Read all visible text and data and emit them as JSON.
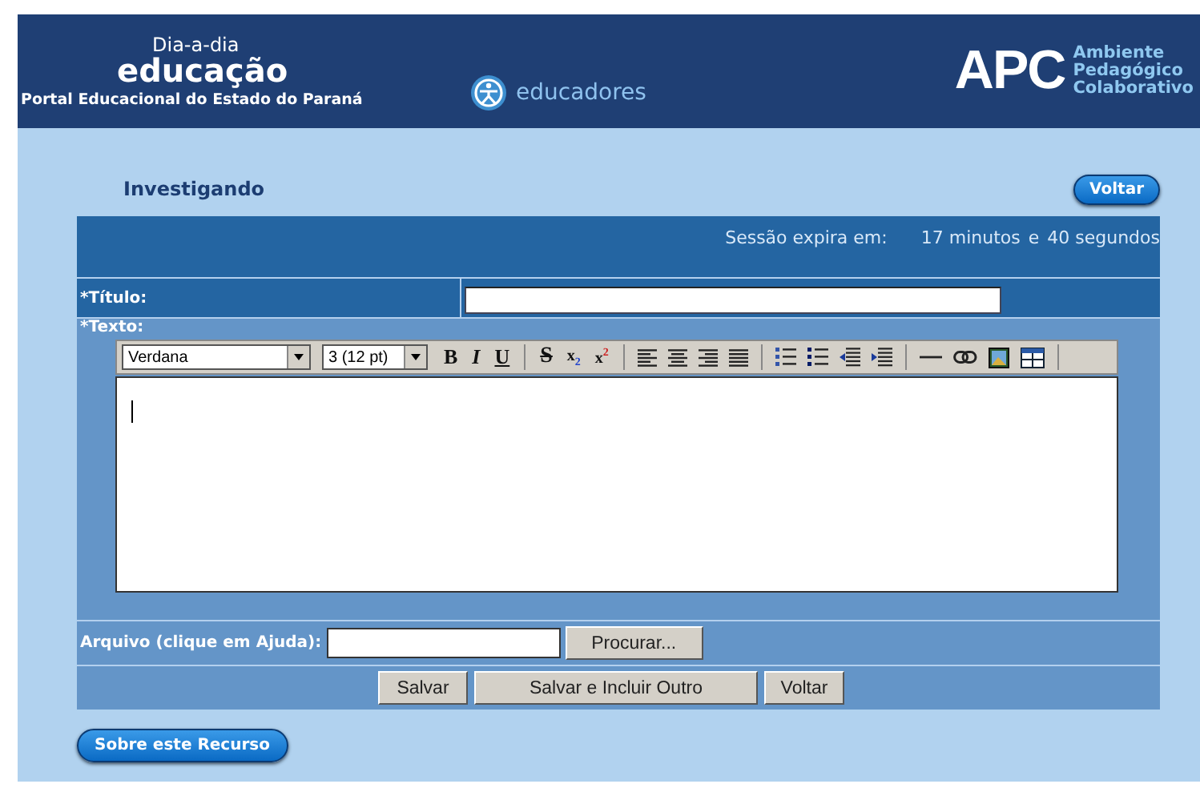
{
  "header": {
    "logo_top": "Dia-a-dia",
    "logo_main": "educação",
    "portal": "Portal Educacional do Estado do Paraná",
    "section": "educadores",
    "apc": "APC",
    "apc_lines": [
      "Ambiente",
      "Pedagógico",
      "Colaborativo"
    ]
  },
  "page": {
    "title": "Investigando",
    "back_button": "Voltar"
  },
  "session": {
    "label": "Sessão expira em:",
    "minutes": "17 minutos",
    "and": "e",
    "seconds": "40 segundos"
  },
  "form": {
    "title_label": "*Título:",
    "text_label": "*Texto:",
    "font_select": "Verdana",
    "size_select": "3 (12 pt)",
    "toolbar": [
      {
        "kind": "bold",
        "label": "B"
      },
      {
        "kind": "italic",
        "label": "I"
      },
      {
        "kind": "underline",
        "label": "U"
      },
      {
        "kind": "separator"
      },
      {
        "kind": "strike",
        "label": "S"
      },
      {
        "kind": "subscript",
        "label": "x$_{2}$"
      },
      {
        "kind": "superscript",
        "label": "x$^{2}$"
      },
      {
        "kind": "separator"
      },
      {
        "kind": "align-left"
      },
      {
        "kind": "align-center"
      },
      {
        "kind": "align-right"
      },
      {
        "kind": "justify"
      },
      {
        "kind": "separator"
      },
      {
        "kind": "ordered-list"
      },
      {
        "kind": "unordered-list"
      },
      {
        "kind": "outdent"
      },
      {
        "kind": "indent"
      },
      {
        "kind": "separator"
      },
      {
        "kind": "rule"
      },
      {
        "kind": "link"
      },
      {
        "kind": "image"
      },
      {
        "kind": "table"
      },
      {
        "kind": "separator"
      }
    ],
    "file_label": "Arquivo (clique em Ajuda):",
    "browse_button": "Procurar...",
    "buttons": [
      "Salvar",
      "Salvar e Incluir Outro",
      "Voltar"
    ]
  },
  "footer_button": "Sobre este Recurso"
}
